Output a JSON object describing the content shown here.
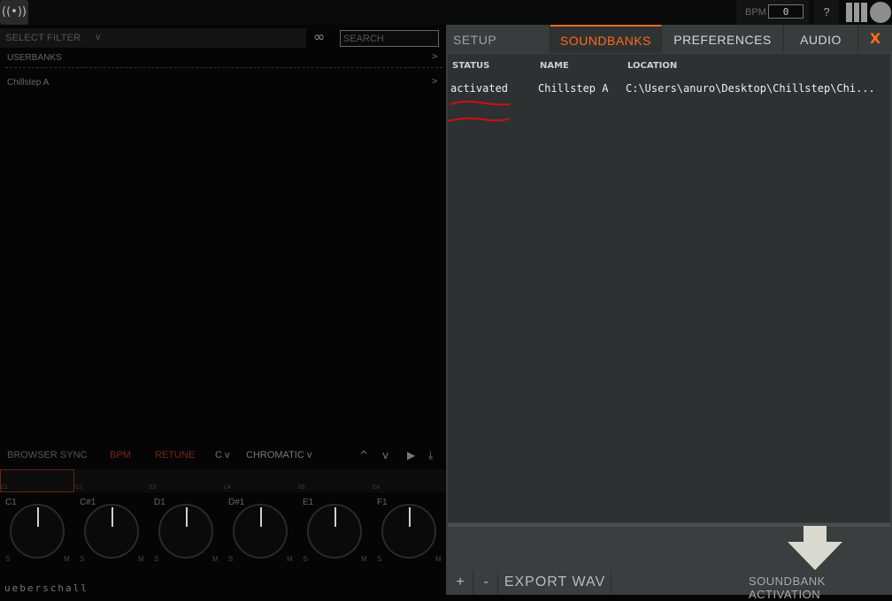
{
  "topbar": {
    "radio_icon": "((•))",
    "bpm_label": "BPM",
    "bpm_value": "0",
    "help_label": "?"
  },
  "browser": {
    "filter_label": "SELECT FILTER",
    "filter_caret": "v",
    "infinity_icon": "∞",
    "search_placeholder": "SEARCH",
    "items": [
      {
        "label": "USERBANKS",
        "arrow": ">"
      },
      {
        "label": "Chillstep A",
        "arrow": ">"
      }
    ]
  },
  "controls": {
    "browser_sync": "BROWSER SYNC",
    "bpm": "BPM",
    "retune": "RETUNE",
    "key": "C v",
    "scale": "CHROMATIC v",
    "icons": {
      "up": "^",
      "down": "v",
      "play": "▶",
      "download": "⤓"
    }
  },
  "keys": {
    "labels": [
      "C1",
      "C2",
      "E3",
      "C4",
      "D5",
      "C6"
    ],
    "knobs": [
      "C1",
      "C#1",
      "D1",
      "D#1",
      "E1",
      "F1"
    ],
    "solo": "S",
    "mute": "M"
  },
  "brand": "ueberschall",
  "tabs": {
    "setup": "SETUP",
    "soundbanks": "SOUNDBANKS",
    "preferences": "PREFERENCES",
    "audio": "AUDIO",
    "close": "X",
    "active": "SOUNDBANKS"
  },
  "table": {
    "headers": {
      "status": "STATUS",
      "name": "NAME",
      "location": "LOCATION"
    },
    "rows": [
      {
        "status": "activated",
        "name": "Chillstep A",
        "location": "C:\\Users\\anuro\\Desktop\\Chillstep\\Chi..."
      }
    ]
  },
  "footer": {
    "add": "+",
    "remove": "-",
    "export": "EXPORT WAV",
    "activation": "SOUNDBANK ACTIVATION"
  },
  "colors": {
    "accent": "#ff6a1a",
    "annotation_red": "#d01010",
    "arrow": "#d9d9cf"
  }
}
